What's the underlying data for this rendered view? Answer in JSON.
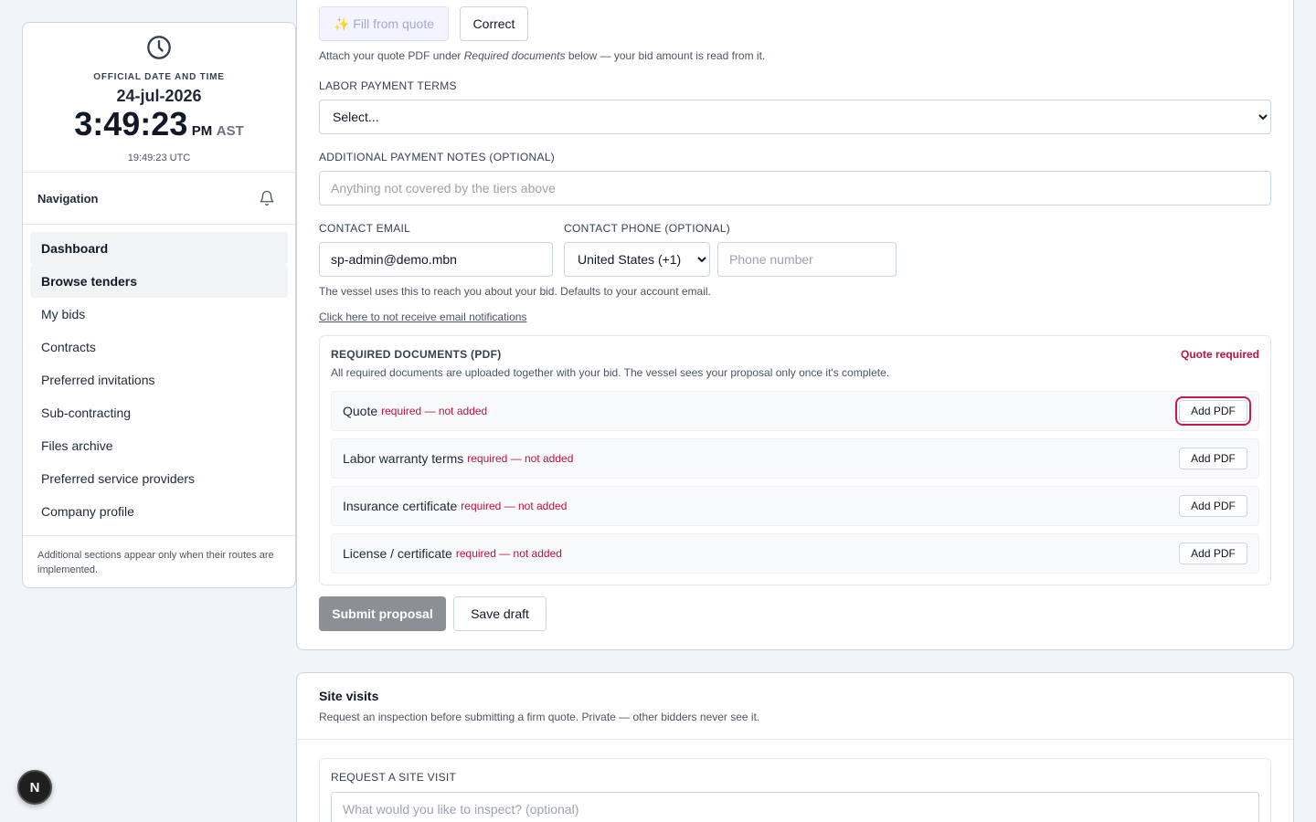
{
  "clock": {
    "label": "OFFICIAL DATE AND TIME",
    "date": "24-jul-2026",
    "time": "3:49:23",
    "ampm": "PM",
    "tz": "AST",
    "utc": "19:49:23 UTC"
  },
  "nav": {
    "title": "Navigation",
    "items": [
      {
        "label": "Dashboard"
      },
      {
        "label": "Browse tenders"
      },
      {
        "label": "My bids"
      },
      {
        "label": "Contracts"
      },
      {
        "label": "Preferred invitations"
      },
      {
        "label": "Sub-contracting"
      },
      {
        "label": "Files archive"
      },
      {
        "label": "Preferred service providers"
      },
      {
        "label": "Company profile"
      }
    ],
    "footnote": "Additional sections appear only when their routes are implemented."
  },
  "bid_form": {
    "fill_label": "✨ Fill from quote",
    "correct_label": "Correct",
    "attach_hint_pre": "Attach your quote PDF under ",
    "attach_hint_em": "Required documents",
    "attach_hint_post": " below — your bid amount is read from it.",
    "labor_terms_label": "LABOR PAYMENT TERMS",
    "labor_terms_value": "Select...",
    "notes_label": "ADDITIONAL PAYMENT NOTES (OPTIONAL)",
    "notes_placeholder": "Anything not covered by the tiers above",
    "email_label": "CONTACT EMAIL",
    "email_value": "sp-admin@demo.mbn",
    "phone_label": "CONTACT PHONE (OPTIONAL)",
    "country_value": "United States (+1)",
    "phone_placeholder": "Phone number",
    "contact_help": "The vessel uses this to reach you about your bid. Defaults to your account email.",
    "optout_link": "Click here to not receive email notifications",
    "docs_title": "REQUIRED DOCUMENTS (PDF)",
    "docs_flag": "Quote required",
    "docs_help": "All required documents are uploaded together with your bid. The vessel sees your proposal only once it's complete.",
    "docs": [
      {
        "name": "Quote",
        "status": "required — not added",
        "button": "Add PDF"
      },
      {
        "name": "Labor warranty terms",
        "status": "required — not added",
        "button": "Add PDF"
      },
      {
        "name": "Insurance certificate",
        "status": "required — not added",
        "button": "Add PDF"
      },
      {
        "name": "License / certificate",
        "status": "required — not added",
        "button": "Add PDF"
      }
    ],
    "submit_label": "Submit proposal",
    "draft_label": "Save draft"
  },
  "site_visits": {
    "title": "Site visits",
    "subtitle": "Request an inspection before submitting a firm quote. Private — other bidders never see it.",
    "request_label": "REQUEST A SITE VISIT",
    "request_placeholder": "What would you like to inspect? (optional)"
  },
  "fab_letter": "N",
  "colors": {
    "danger": "#be123c",
    "focus_ring": "#c8184c",
    "submit_disabled": "#8b8f96",
    "fill_btn_text": "#a5a7d9"
  }
}
